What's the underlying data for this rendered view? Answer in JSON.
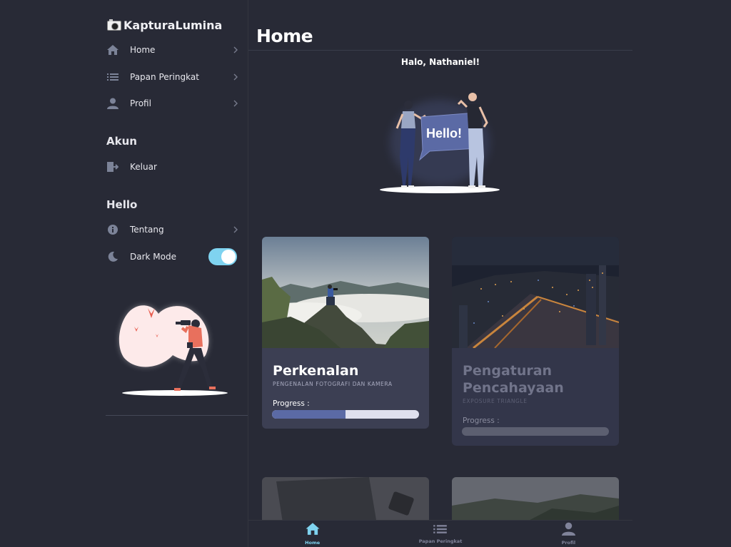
{
  "brand": {
    "name": "KapturaLumina",
    "icon": "camera-icon"
  },
  "sidebar": {
    "items": [
      {
        "label": "Home",
        "icon": "home-icon"
      },
      {
        "label": "Papan Peringkat",
        "icon": "list-icon"
      },
      {
        "label": "Profil",
        "icon": "person-icon"
      }
    ],
    "akun_title": "Akun",
    "logout": {
      "label": "Keluar",
      "icon": "logout-icon"
    },
    "hello_title": "Hello",
    "about": {
      "label": "Tentang",
      "icon": "info-icon"
    },
    "dark_mode": {
      "label": "Dark Mode",
      "icon": "moon-icon",
      "enabled": true
    }
  },
  "main": {
    "title": "Home",
    "greeting": "Halo, Nathaniel!",
    "hero_bubble": "Hello!"
  },
  "cards": [
    {
      "title": "Perkenalan",
      "subtitle": "PENGENALAN FOTOGRAFI DAN KAMERA",
      "progress_label": "Progress :",
      "progress": 0.5,
      "locked": false
    },
    {
      "title": "Pengaturan Pencahayaan",
      "subtitle": "EXPOSURE TRIANGLE",
      "progress_label": "Progress :",
      "progress": 0,
      "locked": true
    }
  ],
  "bottom_nav": [
    {
      "label": "Home",
      "icon": "home-icon",
      "active": true
    },
    {
      "label": "Papan Peringkat",
      "icon": "list-icon",
      "active": false
    },
    {
      "label": "Profil",
      "icon": "person-icon",
      "active": false
    }
  ],
  "colors": {
    "background": "#282a36",
    "card": "#3c3f53",
    "accent": "#7fd3f0",
    "progress_fill": "#5b6aa5"
  }
}
